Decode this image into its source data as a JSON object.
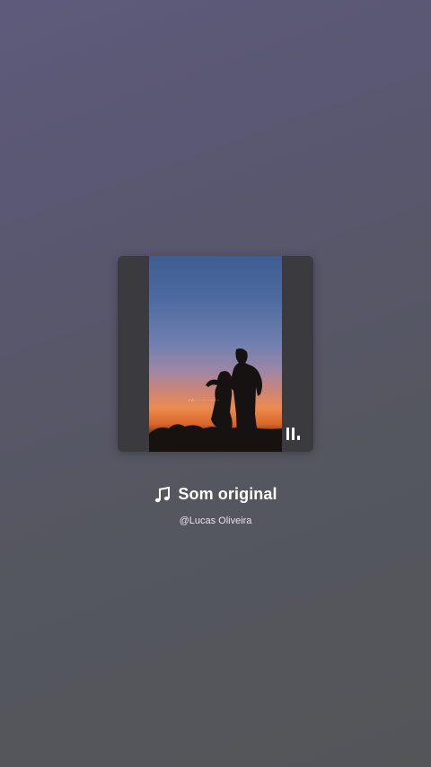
{
  "audio": {
    "title": "Som original",
    "artist": "@Lucas Oliveira",
    "title_icon": "music-note-icon",
    "cover_caption": "I' ñ ·· ·· ··· · ···· ···",
    "state": "playing",
    "control_icon": "pause-icon"
  },
  "colors": {
    "background_top": "#5e5a7c",
    "background_bottom": "#535559",
    "card_side": "#3b3b3f",
    "sunset_orange": "#ec8a4e",
    "sky_blue": "#3e5d8f",
    "text": "#ffffff"
  }
}
